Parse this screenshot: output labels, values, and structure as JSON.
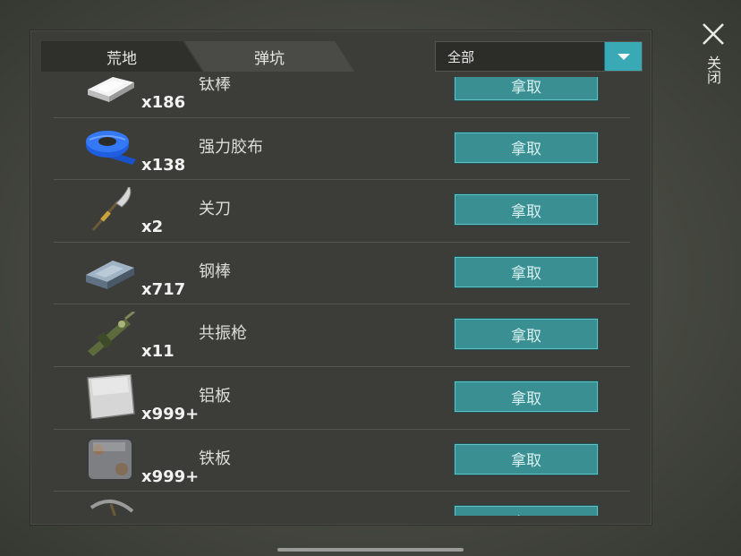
{
  "tabs": [
    {
      "label": "荒地"
    },
    {
      "label": "弹坑"
    }
  ],
  "filter": {
    "selected": "全部"
  },
  "close_label": "关闭",
  "take_label": "拿取",
  "items": [
    {
      "name": "钛棒",
      "qty": "x186",
      "icon": "titanium-bar-icon"
    },
    {
      "name": "强力胶布",
      "qty": "x138",
      "icon": "duct-tape-icon"
    },
    {
      "name": "关刀",
      "qty": "x2",
      "icon": "guandao-blade-icon"
    },
    {
      "name": "钢棒",
      "qty": "x717",
      "icon": "steel-bar-icon"
    },
    {
      "name": "共振枪",
      "qty": "x11",
      "icon": "resonance-gun-icon"
    },
    {
      "name": "铝板",
      "qty": "x999+",
      "icon": "aluminum-plate-icon"
    },
    {
      "name": "铁板",
      "qty": "x999+",
      "icon": "iron-plate-icon"
    },
    {
      "name": "",
      "qty": "",
      "icon": "pickaxe-icon"
    }
  ]
}
